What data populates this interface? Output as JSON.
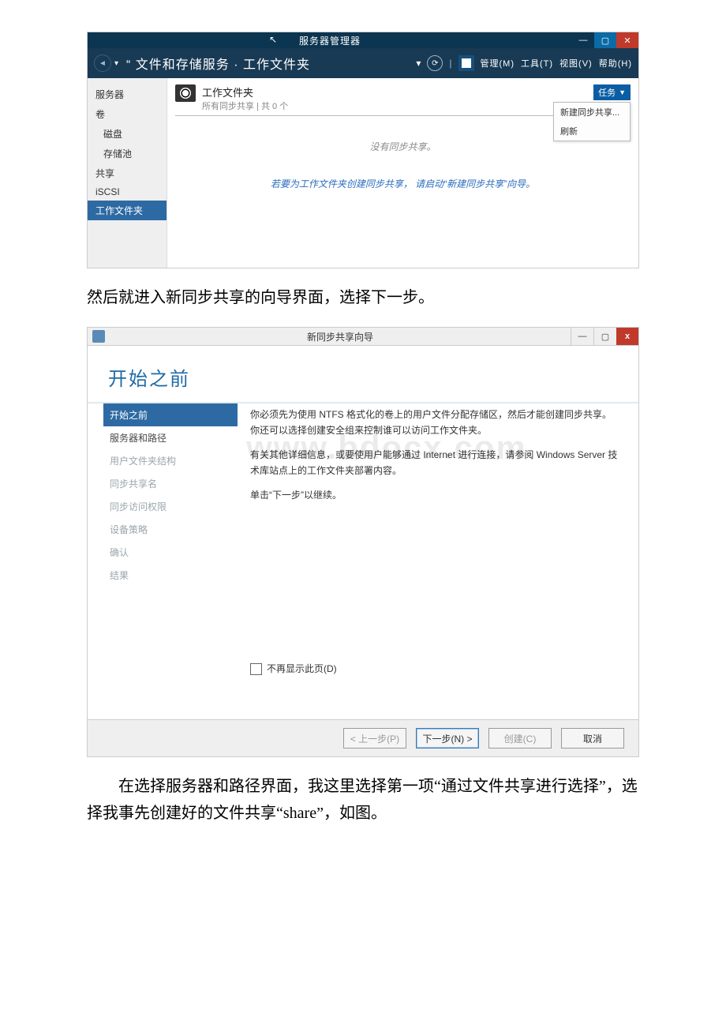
{
  "server_manager": {
    "window_title": "服务器管理器",
    "breadcrumb": "“ 文件和存储服务 · 工作文件夹",
    "menus": {
      "manage": "管理(M)",
      "tools": "工具(T)",
      "view": "视图(V)",
      "help": "帮助(H)"
    },
    "sidebar": {
      "items": [
        {
          "label": "服务器",
          "sub": false
        },
        {
          "label": "卷",
          "sub": false
        },
        {
          "label": "磁盘",
          "sub": true
        },
        {
          "label": "存储池",
          "sub": true
        },
        {
          "label": "共享",
          "sub": false
        },
        {
          "label": "iSCSI",
          "sub": false
        },
        {
          "label": "工作文件夹",
          "sub": false,
          "active": true
        }
      ]
    },
    "group": {
      "title": "工作文件夹",
      "subtitle": "所有同步共享 | 共 0 个"
    },
    "tasks_label": "任务",
    "tasks_menu": {
      "new_share": "新建同步共享...",
      "refresh": "刷新"
    },
    "empty_text": "没有同步共享。",
    "hint_prefix": "若要为工作文件夹创建同步共享，",
    "hint_link": "请启动“新建同步共享”向导。"
  },
  "paragraph1": "然后就进入新同步共享的向导界面，选择下一步。",
  "wizard": {
    "window_title": "新同步共享向导",
    "page_title": "开始之前",
    "steps": [
      {
        "label": "开始之前",
        "state": "active"
      },
      {
        "label": "服务器和路径",
        "state": "enabled"
      },
      {
        "label": "用户文件夹结构",
        "state": "disabled"
      },
      {
        "label": "同步共享名",
        "state": "disabled"
      },
      {
        "label": "同步访问权限",
        "state": "disabled"
      },
      {
        "label": "设备策略",
        "state": "disabled"
      },
      {
        "label": "确认",
        "state": "disabled"
      },
      {
        "label": "结果",
        "state": "disabled"
      }
    ],
    "body": {
      "p1": "你必须先为使用 NTFS 格式化的卷上的用户文件分配存储区，然后才能创建同步共享。你还可以选择创建安全组来控制谁可以访问工作文件夹。",
      "p2": "有关其他详细信息，或要使用户能够通过 Internet 进行连接，请参阅 Windows Server 技术库站点上的工作文件夹部署内容。",
      "p3": "单击“下一步”以继续。"
    },
    "checkbox_label": "不再显示此页(D)",
    "buttons": {
      "prev": "< 上一步(P)",
      "next": "下一步(N) >",
      "create": "创建(C)",
      "cancel": "取消"
    },
    "watermark": "www.bdocx.com"
  },
  "paragraph2": "在选择服务器和路径界面，我这里选择第一项“通过文件共享进行选择”，选择我事先创建好的文件共享“share”，如图。"
}
